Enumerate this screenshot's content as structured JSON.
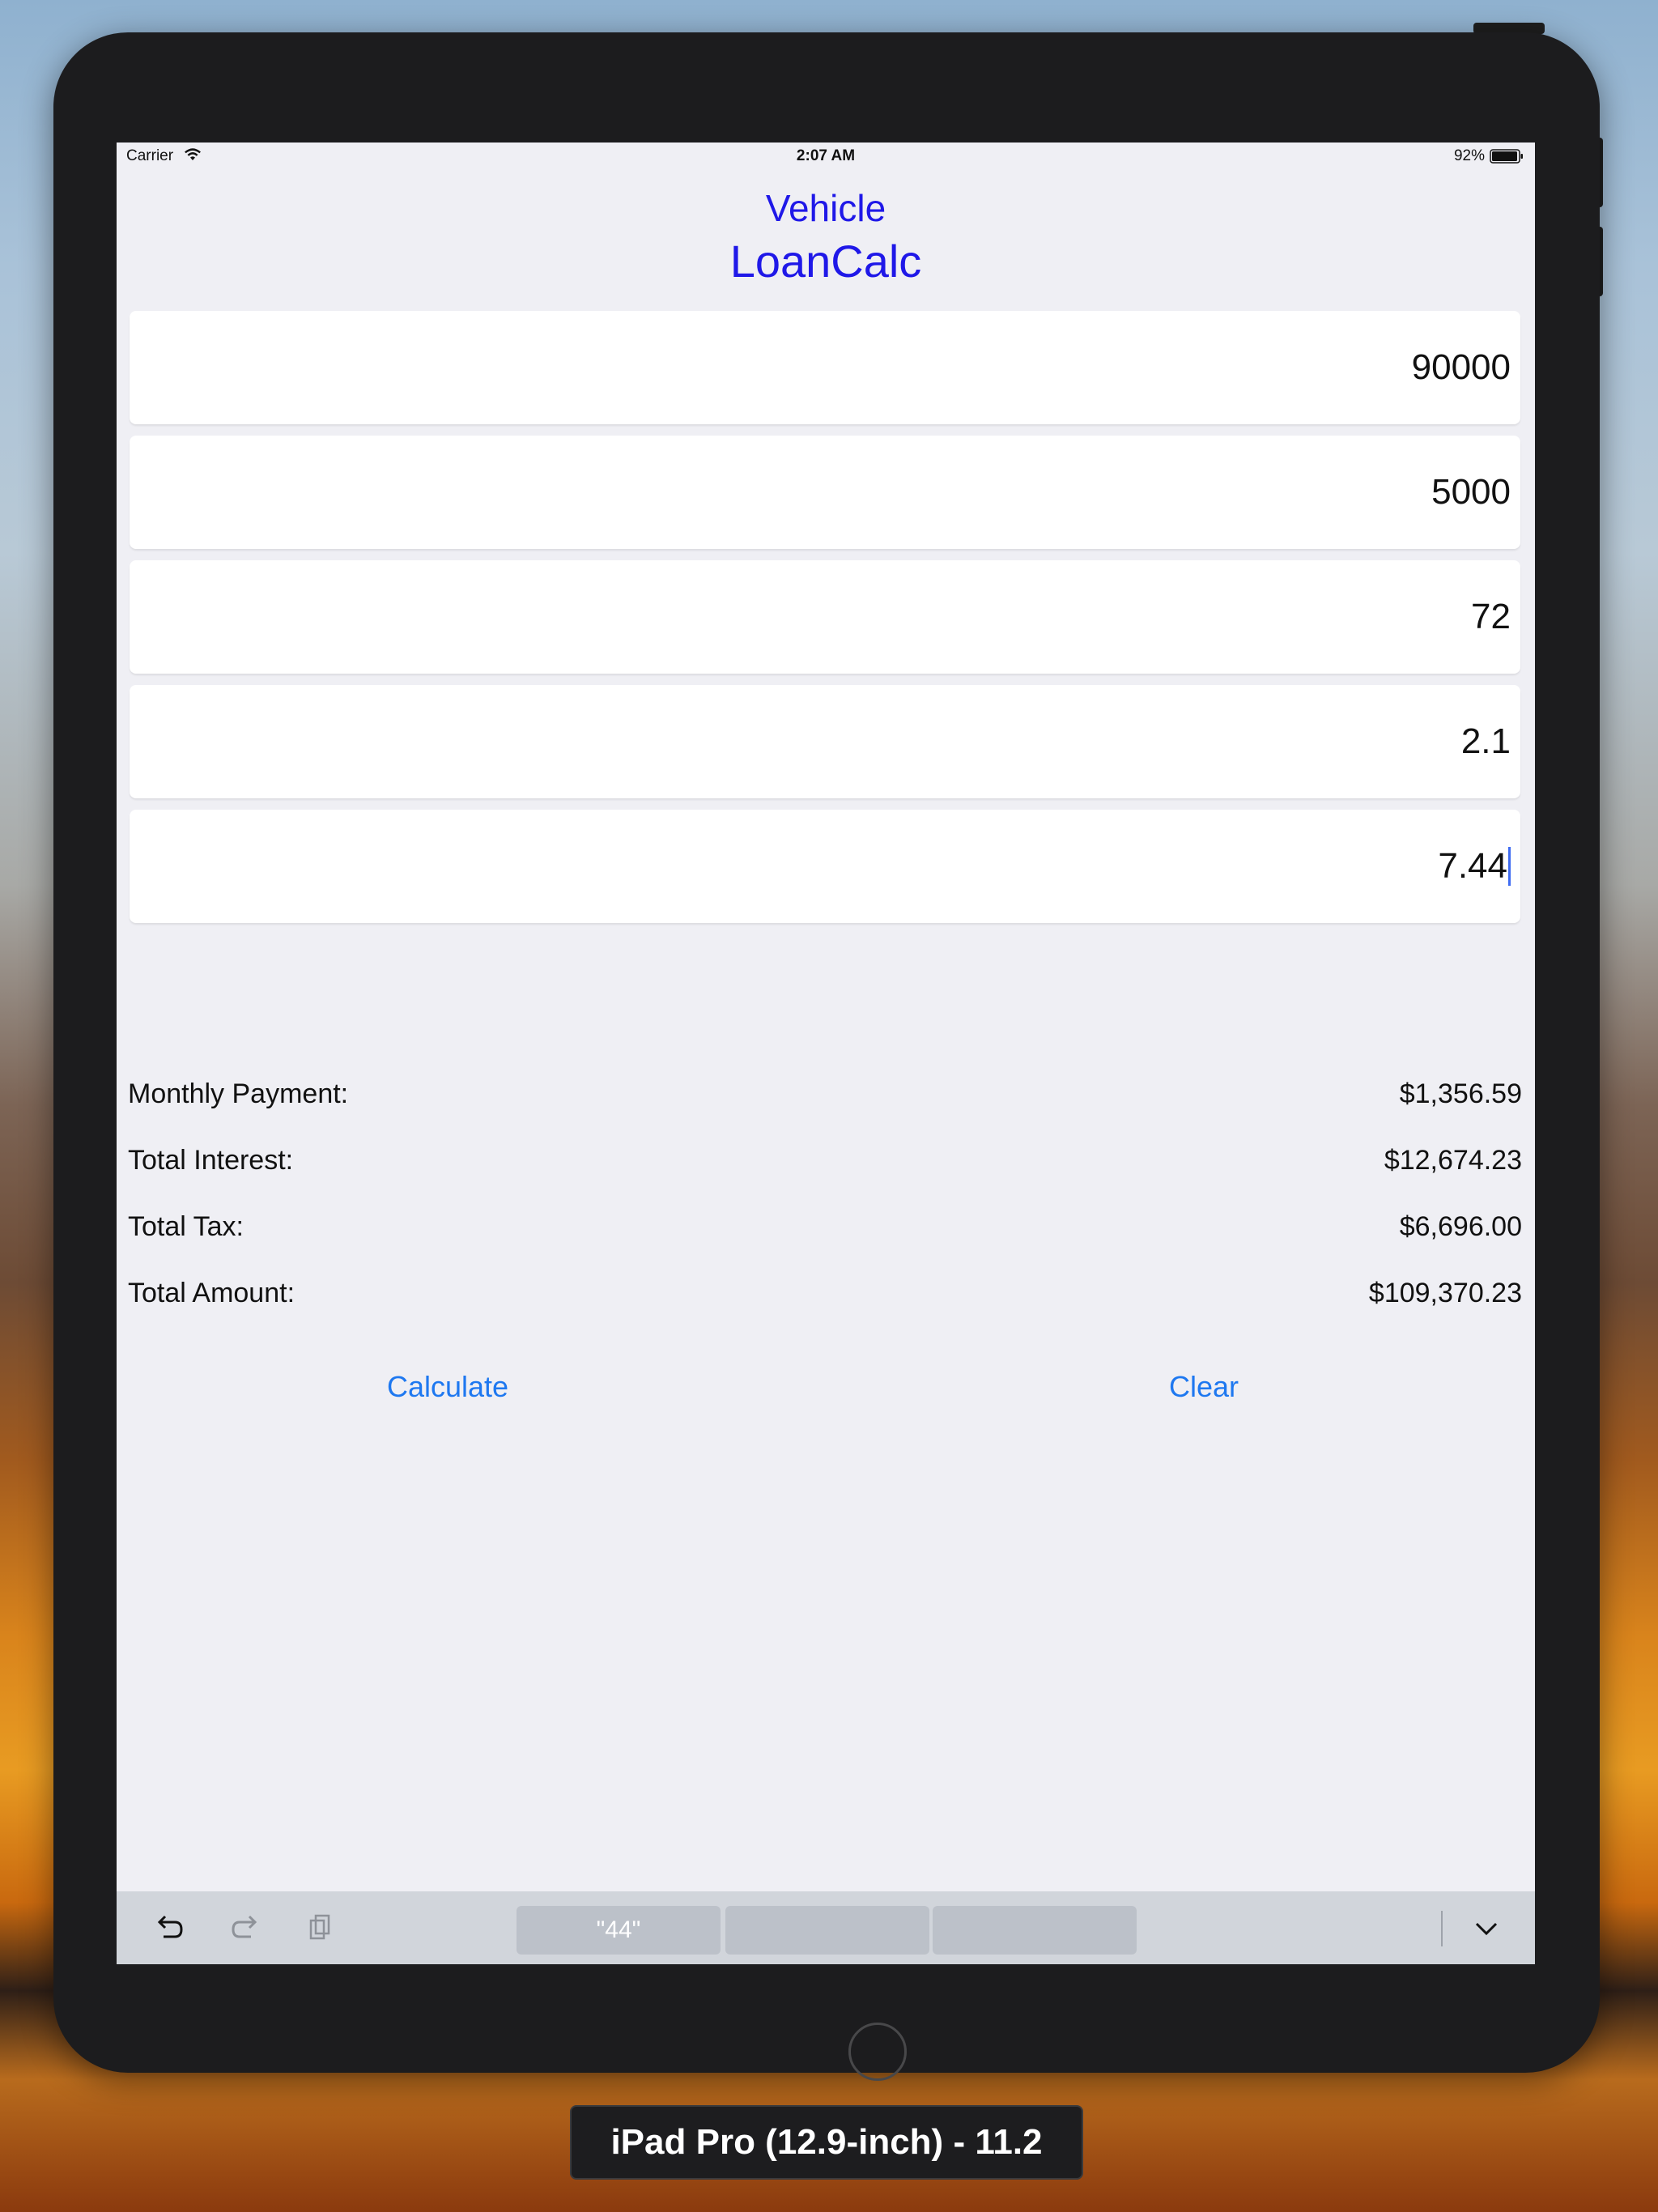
{
  "simulator": {
    "device_label": "iPad Pro (12.9-inch) - 11.2"
  },
  "status_bar": {
    "carrier": "Carrier",
    "time": "2:07 AM",
    "battery": "92%"
  },
  "app": {
    "title_line1": "Vehicle",
    "title_line2": "LoanCalc"
  },
  "fields": [
    {
      "value": "90000"
    },
    {
      "value": "5000"
    },
    {
      "value": "72"
    },
    {
      "value": "2.1"
    },
    {
      "value": "7.44"
    }
  ],
  "results": [
    {
      "label": "Monthly Payment:",
      "value": "$1,356.59"
    },
    {
      "label": "Total Interest:",
      "value": "$12,674.23"
    },
    {
      "label": "Total Tax:",
      "value": "$6,696.00"
    },
    {
      "label": "Total Amount:",
      "value": "$109,370.23"
    }
  ],
  "buttons": {
    "calculate": "Calculate",
    "clear": "Clear"
  },
  "keyboard_bar": {
    "suggestions": [
      "\"44\"",
      "",
      ""
    ],
    "icons": [
      "undo-icon",
      "redo-icon",
      "paste-icon",
      "chevron-down-icon"
    ]
  },
  "colors": {
    "title": "#1f18e8",
    "button": "#1e78f0",
    "screen_bg": "#efeff4"
  }
}
